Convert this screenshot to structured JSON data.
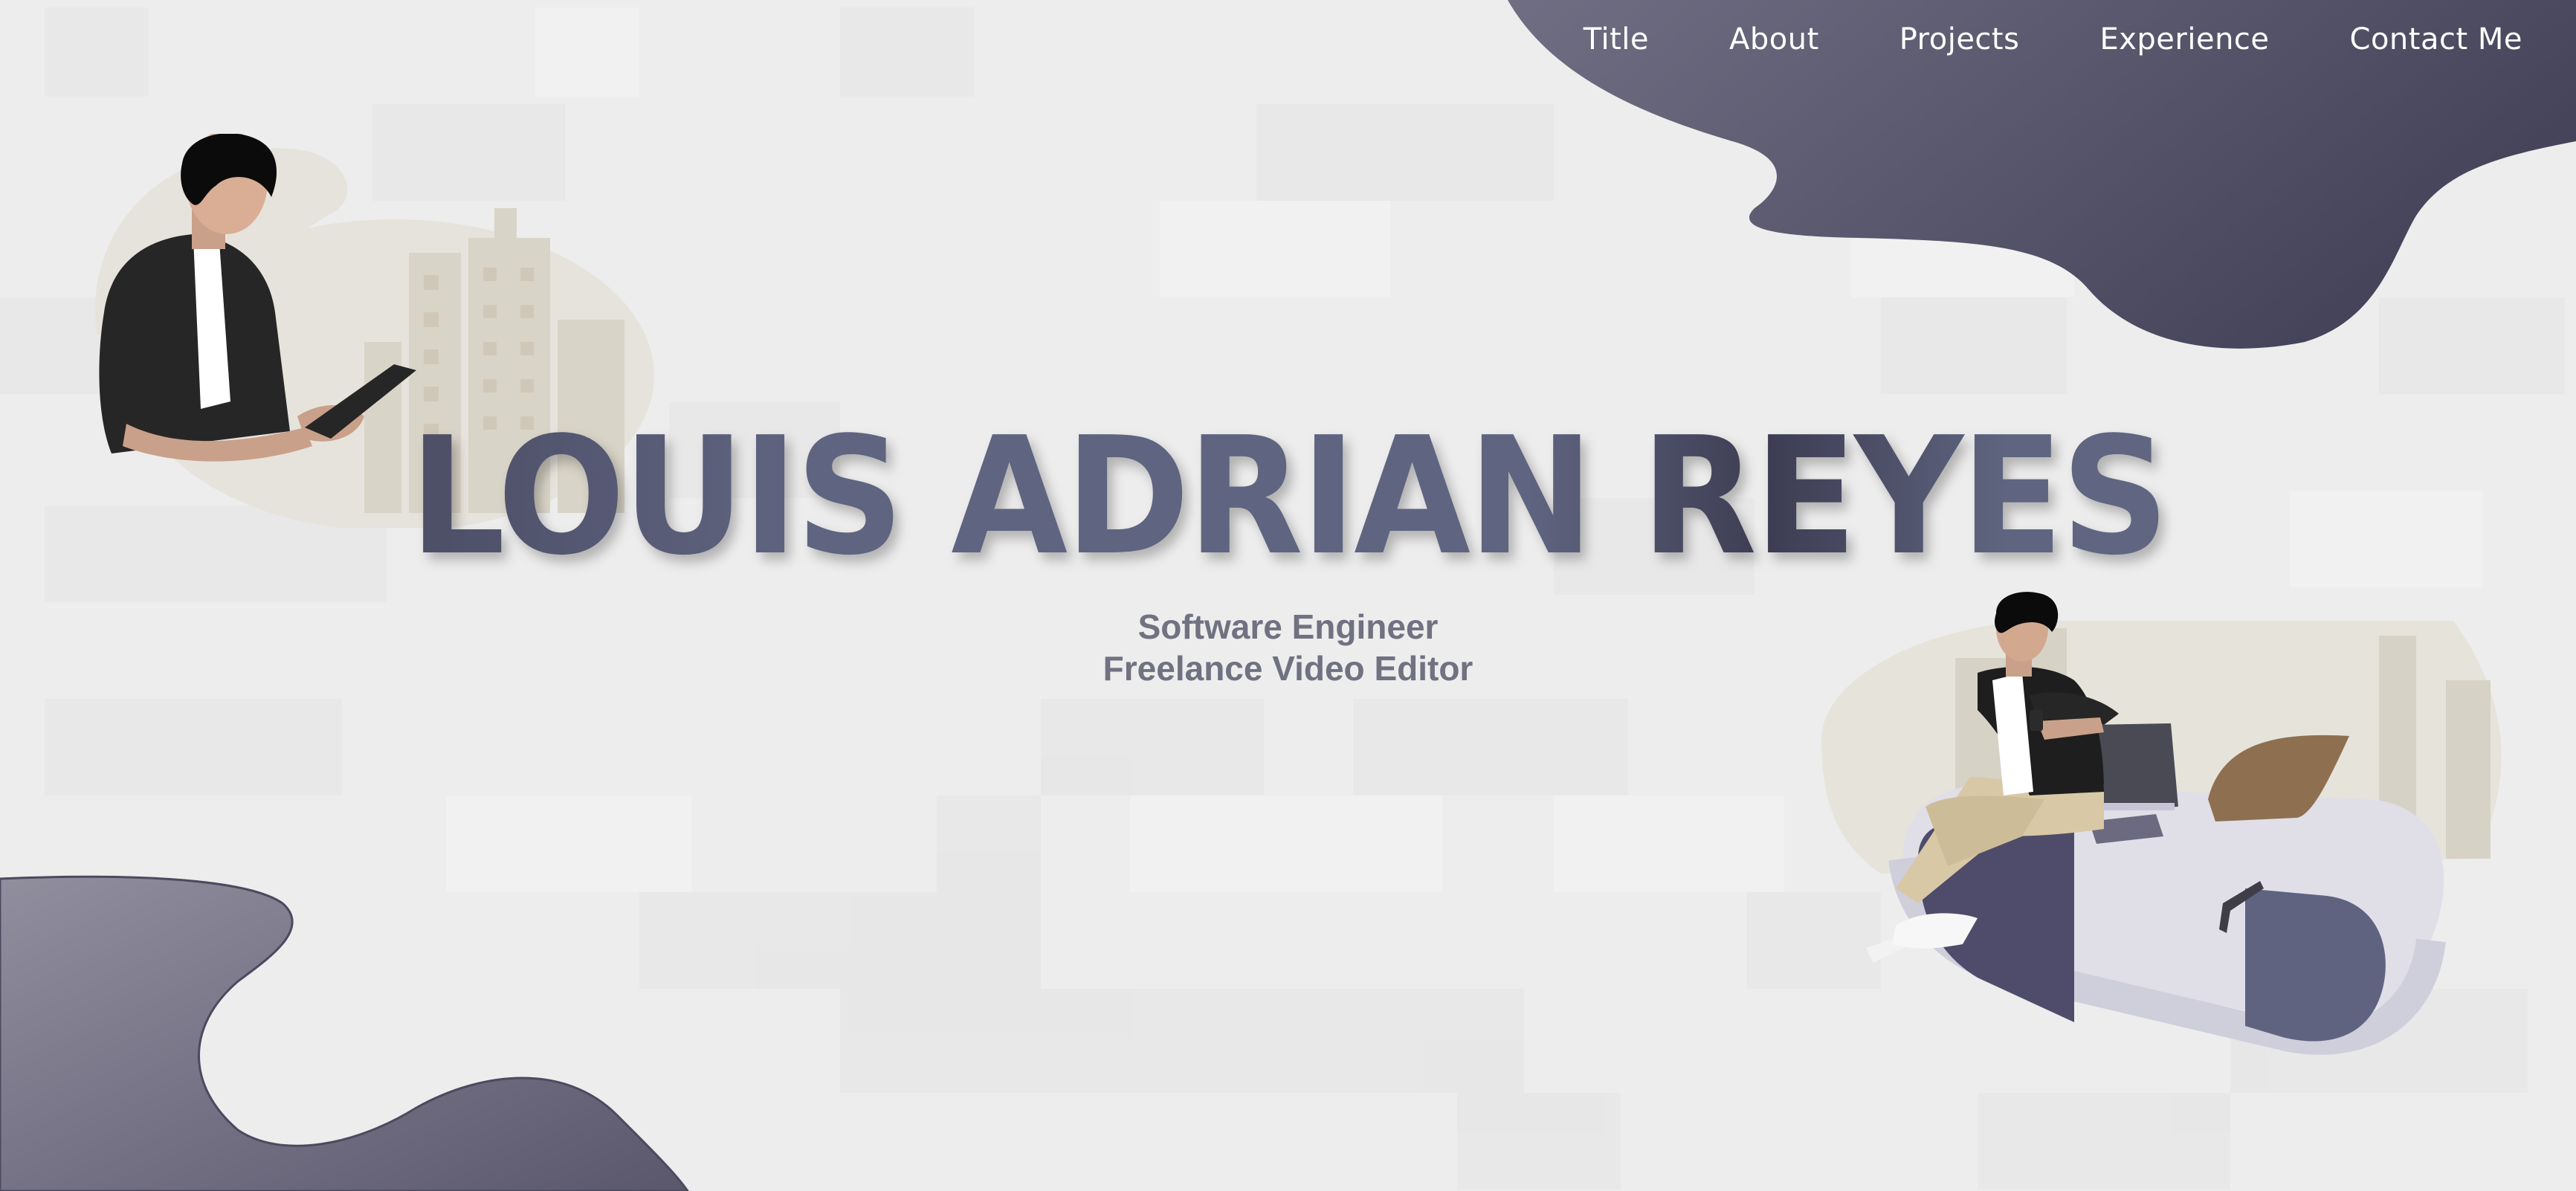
{
  "nav": {
    "items": [
      {
        "label": "Title"
      },
      {
        "label": "About"
      },
      {
        "label": "Projects"
      },
      {
        "label": "Experience"
      },
      {
        "label": "Contact Me"
      }
    ]
  },
  "hero": {
    "name": "LOUIS ADRIAN REYES",
    "roles": [
      "Software Engineer",
      "Freelance Video Editor"
    ]
  },
  "colors": {
    "background": "#ededed",
    "blob_dark": "#4a475d",
    "blob_light": "#908d9d",
    "title_primary": "#5f6480",
    "subtitle": "#707181"
  },
  "illustrations": {
    "left": "person-with-tablet-illustration",
    "right": "person-sitting-on-desk-illustration"
  }
}
